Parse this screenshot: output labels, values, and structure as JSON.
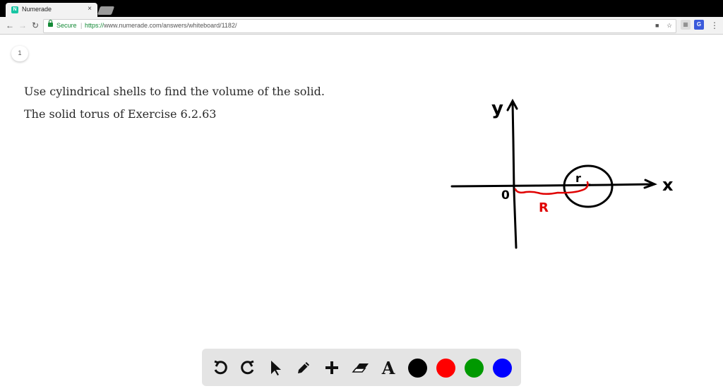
{
  "browser": {
    "tab_title": "Numerade",
    "tab_favicon": "N",
    "close_glyph": "×",
    "secure_label": "Secure",
    "separator": "|",
    "url_protocol": "https://",
    "url_rest": "www.numerade.com/answers/whiteboard/1182/"
  },
  "page": {
    "page_number": "1",
    "question_line1": "Use cylindrical shells to find the volume of the solid.",
    "question_line2": "The solid torus of Exercise 6.2.63"
  },
  "drawing": {
    "y_label": "y",
    "x_label": "x",
    "origin_label": "0",
    "r_label": "r",
    "R_label": "R"
  },
  "palette": {
    "text_tool_glyph": "A",
    "colors": [
      "#000000",
      "#ff0000",
      "#009900",
      "#0000ff"
    ]
  }
}
